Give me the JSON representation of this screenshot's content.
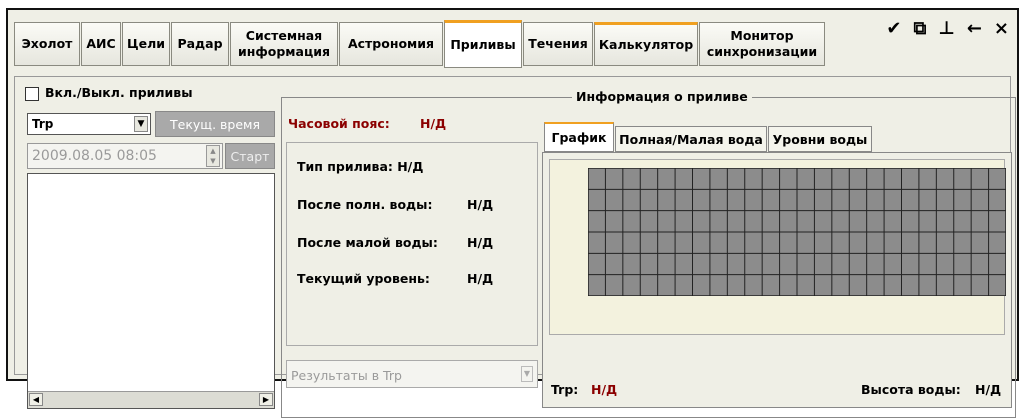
{
  "tabs": [
    {
      "label": "Эхолот"
    },
    {
      "label": "АИС"
    },
    {
      "label": "Цели"
    },
    {
      "label": "Радар"
    },
    {
      "label": "Системная информация"
    },
    {
      "label": "Астрономия"
    },
    {
      "label": "Приливы"
    },
    {
      "label": "Течения"
    },
    {
      "label": "Калькулятор"
    },
    {
      "label": "Монитор синхронизации"
    }
  ],
  "active_tab": "Приливы",
  "toolbar_icons": [
    "pin-brush-icon",
    "restore-window-icon",
    "dock-pin-icon",
    "back-arrow-icon",
    "close-icon"
  ],
  "left": {
    "toggle_label": "Вкл./Выкл. приливы",
    "toggle_checked": false,
    "port_select_value": "Trp",
    "current_time_button": "Текущ. время",
    "datetime_value": "2009.08.05 08:05",
    "start_button": "Старт"
  },
  "info": {
    "legend": "Информация о приливе",
    "timezone_label": "Часовой пояс:",
    "timezone_value": "Н/Д",
    "tide_type": "Тип прилива: Н/Д",
    "after_high_label": "После полн. воды:",
    "after_high_value": "Н/Д",
    "after_low_label": "После малой воды:",
    "after_low_value": "Н/Д",
    "current_level_label": "Текущий уровень:",
    "current_level_value": "Н/Д",
    "results_select": "Результаты в Trp"
  },
  "subtabs": [
    {
      "label": "График"
    },
    {
      "label": "Полная/Малая вода"
    },
    {
      "label": "Уровни воды"
    }
  ],
  "chart_footer": {
    "port_label": "Trp:",
    "port_value": "Н/Д",
    "height_label": "Высота воды:",
    "height_value": "Н/Д"
  },
  "colors": {
    "accent_tab": "#f0a020",
    "warning_text": "#8b0000",
    "grid_fill": "#8c8c8c",
    "chart_bg": "#f3f2de"
  }
}
